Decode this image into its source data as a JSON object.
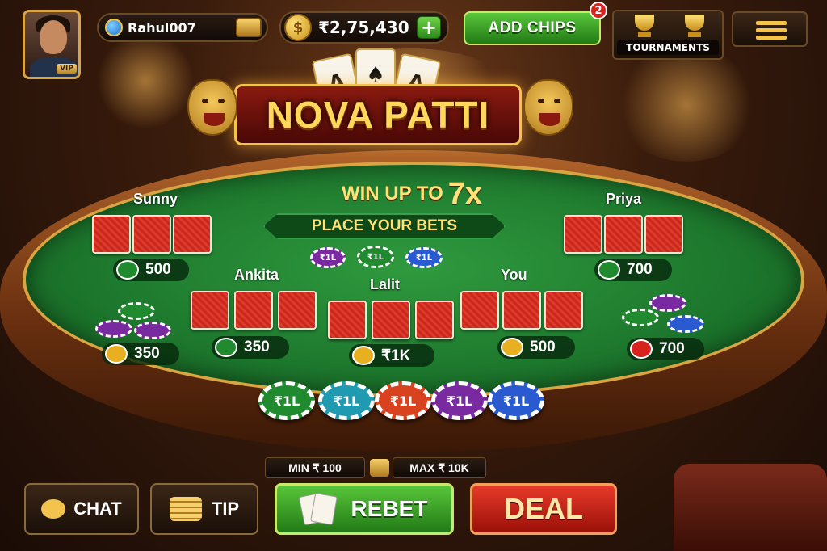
{
  "player": {
    "username": "Rahul007",
    "vip_label": "VIP",
    "balance": "₹2,75,430",
    "plus_label": "+"
  },
  "header": {
    "add_chips_label": "ADD CHIPS",
    "notification_count": "2",
    "tournaments_label": "TOURNAMENTS"
  },
  "logo": {
    "title": "NOVA PATTI",
    "card_symbols": [
      "A",
      "♠",
      "A"
    ]
  },
  "table": {
    "win_prefix": "WIN UP TO",
    "win_multiplier": "7x",
    "place_bets_label": "PLACE YOUR BETS",
    "players": [
      {
        "name": "Sunny",
        "bet": "500"
      },
      {
        "name": "Priya",
        "bet": "700"
      },
      {
        "name": "Ankita",
        "bet": "350"
      },
      {
        "name": "Lalit",
        "bet": "₹1K"
      },
      {
        "name": "You",
        "bet": "500"
      }
    ],
    "side_stacks": {
      "left": "350",
      "right": "700"
    },
    "chip_label": "₹1L"
  },
  "chip_row": [
    "₹1L",
    "₹1L",
    "₹1L",
    "₹1L",
    "₹1L"
  ],
  "chip_colors": [
    "#1f8a2e",
    "#1f9ab0",
    "#d8421e",
    "#7a2aa0",
    "#2a5ad0"
  ],
  "limits": {
    "min_label": "MIN ₹ 100",
    "max_label": "MAX ₹ 10K"
  },
  "buttons": {
    "chat_label": "CHAT",
    "tip_label": "TIP",
    "rebet_label": "REBET",
    "deal_label": "DEAL"
  },
  "icons": [
    "globe-icon",
    "treasure-chest-icon",
    "coin-icon",
    "plus-icon",
    "trophy-icon",
    "menu-icon",
    "chat-bubble-icon",
    "coins-stack-icon",
    "cards-icon",
    "tiger-head-icon"
  ]
}
